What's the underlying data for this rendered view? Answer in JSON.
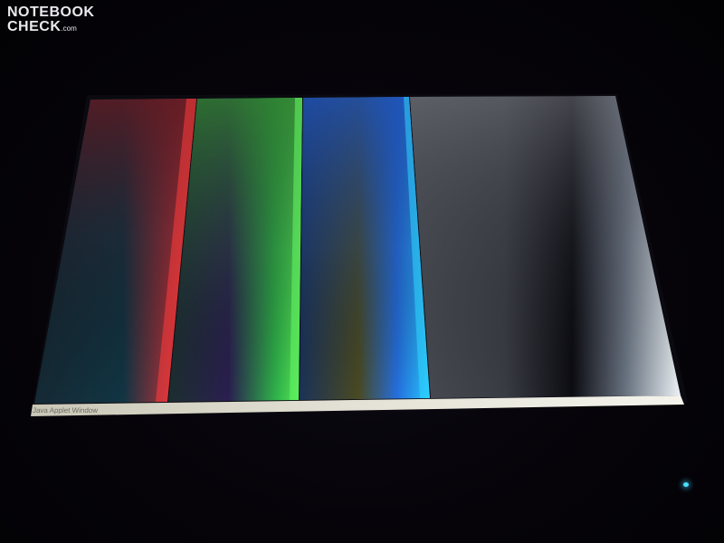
{
  "watermark": {
    "line1": "NOTEBOOK",
    "line2": "CHECK",
    "suffix": ".com"
  },
  "screen": {
    "status_bar_text": "Java Applet Window",
    "bands": [
      {
        "name": "red-gradient-band",
        "color": "#ff3a3a"
      },
      {
        "name": "green-gradient-band",
        "color": "#46f046"
      },
      {
        "name": "blue-gradient-band",
        "color": "#2a8cff"
      },
      {
        "name": "grey-gradient-band",
        "color": "#e6ecf2"
      }
    ]
  },
  "indicators": {
    "power_led_color": "#48e2ff"
  }
}
